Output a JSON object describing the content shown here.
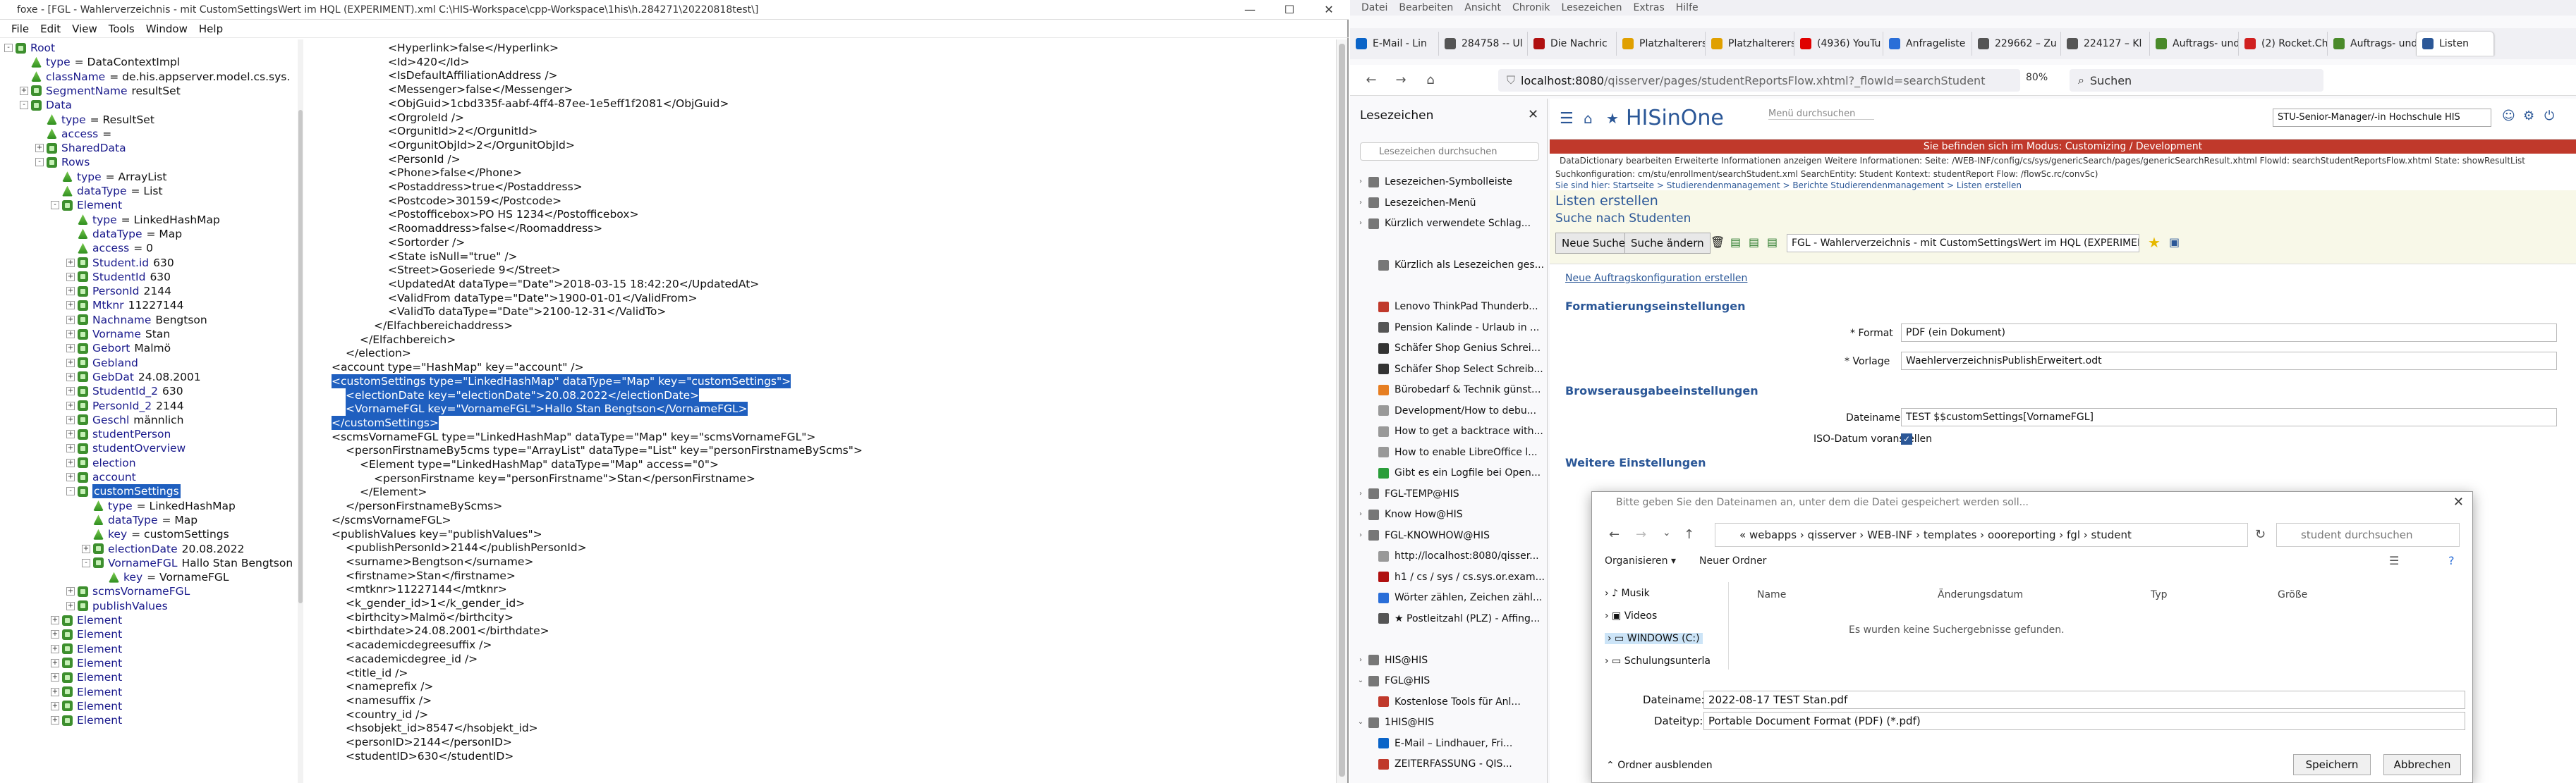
{
  "editor": {
    "title": "foxe - [FGL - Wahlerverzeichnis - mit CustomSettingsWert im HQL (EXPERIMENT).xml  C:\\HIS-Workspace\\cpp-Workspace\\1his\\h.284271\\20220818test\\]",
    "menu": [
      "File",
      "Edit",
      "View",
      "Tools",
      "Window",
      "Help"
    ],
    "tree": [
      {
        "d": 0,
        "e": "-",
        "k": "node",
        "l": "Root",
        "v": ""
      },
      {
        "d": 1,
        "e": "",
        "k": "leaf",
        "l": "type",
        "v": "= DataContextImpl"
      },
      {
        "d": 1,
        "e": "",
        "k": "leaf",
        "l": "className",
        "v": "= de.his.appserver.model.cs.sys."
      },
      {
        "d": 1,
        "e": "+",
        "k": "node",
        "l": "SegmentName",
        "v": "resultSet"
      },
      {
        "d": 1,
        "e": "-",
        "k": "node",
        "l": "Data",
        "v": ""
      },
      {
        "d": 2,
        "e": "",
        "k": "leaf",
        "l": "type",
        "v": "= ResultSet"
      },
      {
        "d": 2,
        "e": "",
        "k": "leaf",
        "l": "access",
        "v": "="
      },
      {
        "d": 2,
        "e": "+",
        "k": "node",
        "l": "SharedData",
        "v": ""
      },
      {
        "d": 2,
        "e": "-",
        "k": "node",
        "l": "Rows",
        "v": ""
      },
      {
        "d": 3,
        "e": "",
        "k": "leaf",
        "l": "type",
        "v": "= ArrayList"
      },
      {
        "d": 3,
        "e": "",
        "k": "leaf",
        "l": "dataType",
        "v": "= List"
      },
      {
        "d": 3,
        "e": "-",
        "k": "node",
        "l": "Element",
        "v": ""
      },
      {
        "d": 4,
        "e": "",
        "k": "leaf",
        "l": "type",
        "v": "= LinkedHashMap"
      },
      {
        "d": 4,
        "e": "",
        "k": "leaf",
        "l": "dataType",
        "v": "= Map"
      },
      {
        "d": 4,
        "e": "",
        "k": "leaf",
        "l": "access",
        "v": "= 0"
      },
      {
        "d": 4,
        "e": "+",
        "k": "node",
        "l": "Student.id",
        "v": "630"
      },
      {
        "d": 4,
        "e": "+",
        "k": "node",
        "l": "StudentId",
        "v": "630"
      },
      {
        "d": 4,
        "e": "+",
        "k": "node",
        "l": "PersonId",
        "v": "2144"
      },
      {
        "d": 4,
        "e": "+",
        "k": "node",
        "l": "Mtknr",
        "v": "11227144"
      },
      {
        "d": 4,
        "e": "+",
        "k": "node",
        "l": "Nachname",
        "v": "Bengtson"
      },
      {
        "d": 4,
        "e": "+",
        "k": "node",
        "l": "Vorname",
        "v": "Stan"
      },
      {
        "d": 4,
        "e": "+",
        "k": "node",
        "l": "Gebort",
        "v": "Malmö"
      },
      {
        "d": 4,
        "e": "+",
        "k": "node",
        "l": "Gebland",
        "v": ""
      },
      {
        "d": 4,
        "e": "+",
        "k": "node",
        "l": "GebDat",
        "v": "24.08.2001"
      },
      {
        "d": 4,
        "e": "+",
        "k": "node",
        "l": "StudentId_2",
        "v": "630"
      },
      {
        "d": 4,
        "e": "+",
        "k": "node",
        "l": "PersonId_2",
        "v": "2144"
      },
      {
        "d": 4,
        "e": "+",
        "k": "node",
        "l": "Geschl",
        "v": "männlich"
      },
      {
        "d": 4,
        "e": "+",
        "k": "node",
        "l": "studentPerson",
        "v": ""
      },
      {
        "d": 4,
        "e": "+",
        "k": "node",
        "l": "studentOverview",
        "v": ""
      },
      {
        "d": 4,
        "e": "+",
        "k": "node",
        "l": "election",
        "v": ""
      },
      {
        "d": 4,
        "e": "+",
        "k": "node",
        "l": "account",
        "v": ""
      },
      {
        "d": 4,
        "e": "-",
        "k": "node",
        "l": "customSettings",
        "v": "",
        "sel": true
      },
      {
        "d": 5,
        "e": "",
        "k": "leaf",
        "l": "type",
        "v": "= LinkedHashMap"
      },
      {
        "d": 5,
        "e": "",
        "k": "leaf",
        "l": "dataType",
        "v": "= Map"
      },
      {
        "d": 5,
        "e": "",
        "k": "leaf",
        "l": "key",
        "v": "= customSettings"
      },
      {
        "d": 5,
        "e": "+",
        "k": "node",
        "l": "electionDate",
        "v": "20.08.2022"
      },
      {
        "d": 5,
        "e": "-",
        "k": "node",
        "l": "VornameFGL",
        "v": "Hallo Stan Bengtson"
      },
      {
        "d": 6,
        "e": "",
        "k": "leaf",
        "l": "key",
        "v": "= VornameFGL"
      },
      {
        "d": 4,
        "e": "+",
        "k": "node",
        "l": "scmsVornameFGL",
        "v": ""
      },
      {
        "d": 4,
        "e": "+",
        "k": "node",
        "l": "publishValues",
        "v": ""
      },
      {
        "d": 3,
        "e": "+",
        "k": "node",
        "l": "Element",
        "v": ""
      },
      {
        "d": 3,
        "e": "+",
        "k": "node",
        "l": "Element",
        "v": ""
      },
      {
        "d": 3,
        "e": "+",
        "k": "node",
        "l": "Element",
        "v": ""
      },
      {
        "d": 3,
        "e": "+",
        "k": "node",
        "l": "Element",
        "v": ""
      },
      {
        "d": 3,
        "e": "+",
        "k": "node",
        "l": "Element",
        "v": ""
      },
      {
        "d": 3,
        "e": "+",
        "k": "node",
        "l": "Element",
        "v": ""
      },
      {
        "d": 3,
        "e": "+",
        "k": "node",
        "l": "Element",
        "v": ""
      },
      {
        "d": 3,
        "e": "+",
        "k": "node",
        "l": "Element",
        "v": ""
      }
    ],
    "xml": [
      {
        "i": 10,
        "s": "<Hyperlink>false</Hyperlink>"
      },
      {
        "i": 10,
        "s": "<Id>420</Id>"
      },
      {
        "i": 10,
        "s": "<IsDefaultAffiliationAddress />"
      },
      {
        "i": 10,
        "s": "<Messenger>false</Messenger>"
      },
      {
        "i": 10,
        "s": "<ObjGuid>1cbd335f-aabf-4ff4-87ee-1e5eff1f2081</ObjGuid>"
      },
      {
        "i": 10,
        "s": "<OrgroleId />"
      },
      {
        "i": 10,
        "s": "<OrgunitId>2</OrgunitId>"
      },
      {
        "i": 10,
        "s": "<OrgunitObjId>2</OrgunitObjId>"
      },
      {
        "i": 10,
        "s": "<PersonId />"
      },
      {
        "i": 10,
        "s": "<Phone>false</Phone>"
      },
      {
        "i": 10,
        "s": "<Postaddress>true</Postaddress>"
      },
      {
        "i": 10,
        "s": "<Postcode>30159</Postcode>"
      },
      {
        "i": 10,
        "s": "<Postofficebox>PO HS 1234</Postofficebox>"
      },
      {
        "i": 10,
        "s": "<Roomaddress>false</Roomaddress>"
      },
      {
        "i": 10,
        "s": "<Sortorder />"
      },
      {
        "i": 10,
        "s": "<State isNull=\"true\" />"
      },
      {
        "i": 10,
        "s": "<Street>Goseriede 9</Street>"
      },
      {
        "i": 10,
        "s": "<UpdatedAt dataType=\"Date\">2018-03-15 18:42:20</UpdatedAt>"
      },
      {
        "i": 10,
        "s": "<ValidFrom dataType=\"Date\">1900-01-01</ValidFrom>"
      },
      {
        "i": 10,
        "s": "<ValidTo dataType=\"Date\">2100-12-31</ValidTo>"
      },
      {
        "i": 8,
        "s": "</Elfachbereichaddress>"
      },
      {
        "i": 6,
        "s": "</Elfachbereich>"
      },
      {
        "i": 4,
        "s": "</election>"
      },
      {
        "i": 2,
        "s": "<account type=\"HashMap\" key=\"account\" />"
      },
      {
        "i": 2,
        "s": "<customSettings type=\"LinkedHashMap\" dataType=\"Map\" key=\"customSettings\">",
        "hl": true
      },
      {
        "i": 4,
        "s": "<electionDate key=\"electionDate\">20.08.2022</electionDate>",
        "hl": true
      },
      {
        "i": 4,
        "s": "<VornameFGL key=\"VornameFGL\">Hallo Stan Bengtson</VornameFGL>",
        "hl": true
      },
      {
        "i": 2,
        "s": "</customSettings>",
        "hl": true
      },
      {
        "i": 2,
        "s": "<scmsVornameFGL type=\"LinkedHashMap\" dataType=\"Map\" key=\"scmsVornameFGL\">"
      },
      {
        "i": 4,
        "s": "<personFirstnameBy5cms type=\"ArrayList\" dataType=\"List\" key=\"personFirstnameByScms\">"
      },
      {
        "i": 6,
        "s": "<Element type=\"LinkedHashMap\" dataType=\"Map\" access=\"0\">"
      },
      {
        "i": 8,
        "s": "<personFirstname key=\"personFirstname\">Stan</personFirstname>"
      },
      {
        "i": 6,
        "s": "</Element>"
      },
      {
        "i": 4,
        "s": "</personFirstnameByScms>"
      },
      {
        "i": 2,
        "s": "</scmsVornameFGL>"
      },
      {
        "i": 2,
        "s": "<publishValues key=\"publishValues\">"
      },
      {
        "i": 4,
        "s": "<publishPersonId>2144</publishPersonId>"
      },
      {
        "i": 4,
        "s": "<surname>Bengtson</surname>"
      },
      {
        "i": 4,
        "s": "<firstname>Stan</firstname>"
      },
      {
        "i": 4,
        "s": "<mtknr>11227144</mtknr>"
      },
      {
        "i": 4,
        "s": "<k_gender_id>1</k_gender_id>"
      },
      {
        "i": 4,
        "s": "<birthcity>Malmö</birthcity>"
      },
      {
        "i": 4,
        "s": "<birthdate>24.08.2001</birthdate>"
      },
      {
        "i": 4,
        "s": "<academicdegreesuffix />"
      },
      {
        "i": 4,
        "s": "<academicdegree_id />"
      },
      {
        "i": 4,
        "s": "<title_id />"
      },
      {
        "i": 4,
        "s": "<nameprefix />"
      },
      {
        "i": 4,
        "s": "<namesuffix />"
      },
      {
        "i": 4,
        "s": "<country_id />"
      },
      {
        "i": 4,
        "s": "<hsobjekt_id>8547</hsobjekt_id>"
      },
      {
        "i": 4,
        "s": "<personID>2144</personID>"
      },
      {
        "i": 4,
        "s": "<studentID>630</studentID>"
      }
    ]
  },
  "browser": {
    "menu": [
      "Datei",
      "Bearbeiten",
      "Ansicht",
      "Chronik",
      "Lesezeichen",
      "Extras",
      "Hilfe"
    ],
    "tabs": [
      {
        "label": "E-Mail - Lin",
        "color": "#0a64c8"
      },
      {
        "label": "284758 -- Ul",
        "color": "#555"
      },
      {
        "label": "Die Nachric",
        "color": "#b01010"
      },
      {
        "label": "Platzhalterersetz",
        "color": "#e0a000"
      },
      {
        "label": "Platzhalterersetz",
        "color": "#e0a000"
      },
      {
        "label": "(4936) YouTu",
        "color": "#e00000"
      },
      {
        "label": "Anfrageliste",
        "color": "#2a6ed8"
      },
      {
        "label": "229662 – Zu",
        "color": "#555"
      },
      {
        "label": "224127 – Kl",
        "color": "#555"
      },
      {
        "label": "Auftrags- und A",
        "color": "#4a8a2a"
      },
      {
        "label": "(2) Rocket.Ch",
        "color": "#d02020"
      },
      {
        "label": "Auftrags- und A",
        "color": "#4a8a2a"
      },
      {
        "label": "Listen",
        "color": "#2b5797",
        "active": true
      }
    ],
    "url_host": "localhost:8080",
    "url_path": "/qisserver/pages/studentReportsFlow.xhtml?_flowId=searchStudent",
    "zoom": "80%",
    "search_placeholder": "Suchen"
  },
  "bookmarks": {
    "title": "Lesezeichen",
    "search_placeholder": "Lesezeichen durchsuchen",
    "items": [
      {
        "a": "›",
        "l": "Lesezeichen-Symbolleiste",
        "c": "#777"
      },
      {
        "a": "›",
        "l": "Lesezeichen-Menü",
        "c": "#777"
      },
      {
        "a": "›",
        "l": "Kürzlich verwendete Schlag...",
        "c": "#777"
      },
      {
        "a": "",
        "l": "",
        "c": ""
      },
      {
        "a": "",
        "l": "Kürzlich als Lesezeichen ges...",
        "c": "#777"
      },
      {
        "a": "",
        "l": "",
        "c": ""
      },
      {
        "a": "",
        "l": "Lenovo ThinkPad Thunderb...",
        "c": "#c0392b"
      },
      {
        "a": "",
        "l": "Pension Kalinde - Urlaub in ...",
        "c": "#555"
      },
      {
        "a": "",
        "l": "Schäfer Shop Genius Schrei...",
        "c": "#333"
      },
      {
        "a": "",
        "l": "Schäfer Shop Select Schreib...",
        "c": "#333"
      },
      {
        "a": "",
        "l": "Bürobedarf & Technik günst...",
        "c": "#e67e22"
      },
      {
        "a": "",
        "l": "Development/How to debu...",
        "c": "#999"
      },
      {
        "a": "",
        "l": "How to get a backtrace with...",
        "c": "#999"
      },
      {
        "a": "",
        "l": "How to enable LibreOffice l...",
        "c": "#999"
      },
      {
        "a": "",
        "l": "Gibt es ein Logfile bei Open...",
        "c": "#2a9d3a"
      },
      {
        "a": "›",
        "l": "FGL-TEMP@HIS",
        "c": "#777"
      },
      {
        "a": "›",
        "l": "Know How@HIS",
        "c": "#777"
      },
      {
        "a": "›",
        "l": "FGL-KNOWHOW@HIS",
        "c": "#777"
      },
      {
        "a": "",
        "l": "http://localhost:8080/qisser...",
        "c": "#999"
      },
      {
        "a": "",
        "l": "h1 / cs / sys / cs.sys.or.exam...",
        "c": "#b01010"
      },
      {
        "a": "",
        "l": "Wörter zählen, Zeichen zähl...",
        "c": "#2a6ed8"
      },
      {
        "a": "",
        "l": "★ Postleitzahl (PLZ) - Affing...",
        "c": "#555"
      },
      {
        "a": "",
        "l": "",
        "c": ""
      },
      {
        "a": "›",
        "l": "HIS@HIS",
        "c": "#777"
      },
      {
        "a": "⌄",
        "l": "FGL@HIS",
        "c": "#777"
      },
      {
        "a": "",
        "l": "Kostenlose Tools für Anl...",
        "c": "#c0392b"
      },
      {
        "a": "⌄",
        "l": "1HIS@HIS",
        "c": "#777"
      },
      {
        "a": "",
        "l": "E-Mail – Lindhauer, Fri...",
        "c": "#0a64c8"
      },
      {
        "a": "",
        "l": "ZEITERFASSUNG - QIS...",
        "c": "#c0392b"
      }
    ]
  },
  "his": {
    "logo": "HISinOne",
    "menu_search": "Menü durchsuchen",
    "role": "STU-Senior-Manager/-in Hochschule HIS",
    "mode_banner": "Sie befinden sich im Modus: Customizing / Development",
    "dev_bar": "DataDictionary bearbeiten   Erweiterte Informationen anzeigen   Weitere Informationen:  Seite: /WEB-INF/config/cs/sys/genericSearch/pages/genericSearchResult.xhtml  Flowld: searchStudentReportsFlow.xhtml  State: showResultList",
    "dev_bar2": "Suchkonfiguration: cm/stu/enrollment/searchStudent.xml  SearchEntity: Student  Kontext: studentReport  Flow: /flowSc.rc/convSc)",
    "breadcrumb": "Sie sind hier:  Startseite  >  Studierendenmanagement  >  Berichte Studierendenmanagement  >  Listen erstellen",
    "page_title": "Listen erstellen",
    "sub_title": "Suche nach Studenten",
    "btn_new": "Neue Suche",
    "btn_change": "Suche ändern",
    "report_select": "FGL - Wahlerverzeichnis - mit CustomSettingsWert im HQL (EXPERIMENT)",
    "create_link": "Neue Auftragskonfiguration erstellen",
    "sec_format": "Formatierungseinstellungen",
    "format_label": "* Format",
    "format_value": "PDF (ein Dokument)",
    "vorlage_label": "* Vorlage",
    "vorlage_value": "WaehlerverzeichnisPublishErweitert.odt",
    "sec_browser": "Browserausgabeeinstellungen",
    "dateiname_label": "Dateiname",
    "dateiname_value": "TEST $$customSettings[VornameFGL]",
    "iso_label": "ISO-Datum voranstellen",
    "sec_more": "Weitere Einstellungen"
  },
  "dialog": {
    "title": "Bitte geben Sie den Dateinamen an, unter dem die Datei gespeichert werden soll...",
    "path": "«  webapps  ›  qisserver  ›  WEB-INF  ›  templates  ›  oooreporting  ›  fgl  ›  student",
    "search": "student durchsuchen",
    "organize": "Organisieren ▾",
    "new_folder": "Neuer Ordner",
    "left_items": [
      "Musik",
      "Videos",
      "WINDOWS (C:)",
      "Schulungsunterla"
    ],
    "cols": [
      "Name",
      "Änderungsdatum",
      "Typ",
      "Größe"
    ],
    "empty": "Es wurden keine Suchergebnisse gefunden.",
    "filename_label": "Dateiname:",
    "filename_value": "2022-08-17 TEST Stan.pdf",
    "filetype_label": "Dateityp:",
    "filetype_value": "Portable Document Format (PDF) (*.pdf)",
    "hide_folders": "Ordner ausblenden",
    "save": "Speichern",
    "cancel": "Abbrechen"
  }
}
